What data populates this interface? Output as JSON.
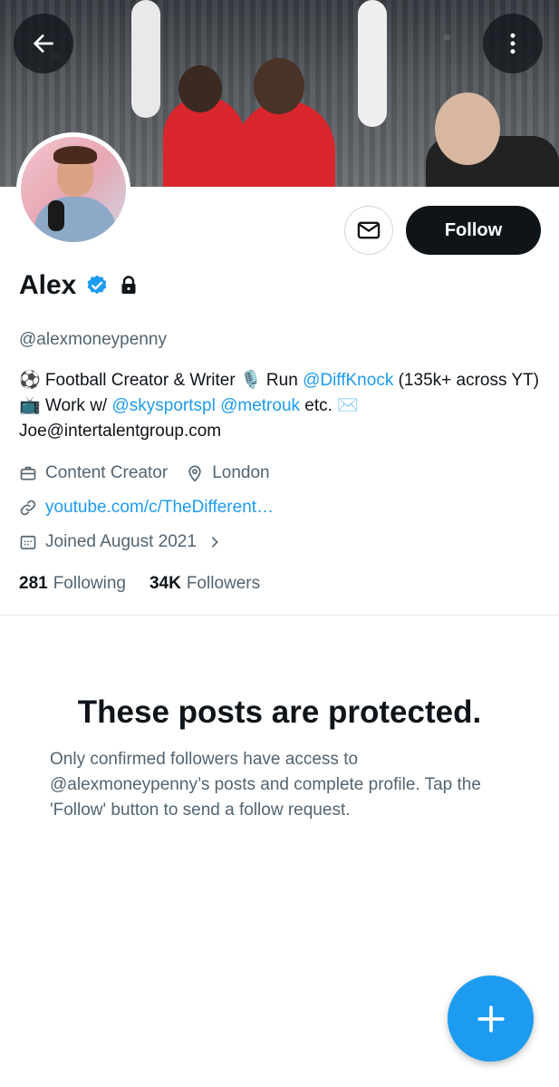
{
  "profile": {
    "name": "Alex",
    "handle": "@alexmoneypenny",
    "bio": {
      "p1": "⚽ Football Creator & Writer 🎙️ Run ",
      "mention1": "@DiffKnock",
      "p2": " (135k+ across YT) 📺 Work w/ ",
      "mention2": "@skysportspl",
      "p3": " ",
      "mention3": "@metrouk",
      "p4": " etc. ✉️ Joe@intertalentgroup.com"
    },
    "category": "Content Creator",
    "location": "London",
    "website": "youtube.com/c/TheDifferent…",
    "joined": "Joined August 2021",
    "following_count": "281",
    "following_label": "Following",
    "followers_count": "34K",
    "followers_label": "Followers"
  },
  "actions": {
    "follow_label": "Follow"
  },
  "protected": {
    "title": "These posts are protected.",
    "body": "Only confirmed followers have access to @alexmoneypenny’s posts and complete profile. Tap the 'Follow' button to send a follow request."
  },
  "icons": {
    "back": "arrow-left-icon",
    "more": "more-vertical-icon",
    "message": "envelope-icon",
    "verified": "verified-badge-icon",
    "protected": "lock-icon",
    "category": "briefcase-icon",
    "location": "location-pin-icon",
    "website": "link-icon",
    "joined": "calendar-icon",
    "compose": "plus-icon"
  },
  "colors": {
    "accent": "#1d9bf0",
    "text_primary": "#0f1419",
    "text_secondary": "#536471",
    "button_dark": "#0f1419"
  }
}
